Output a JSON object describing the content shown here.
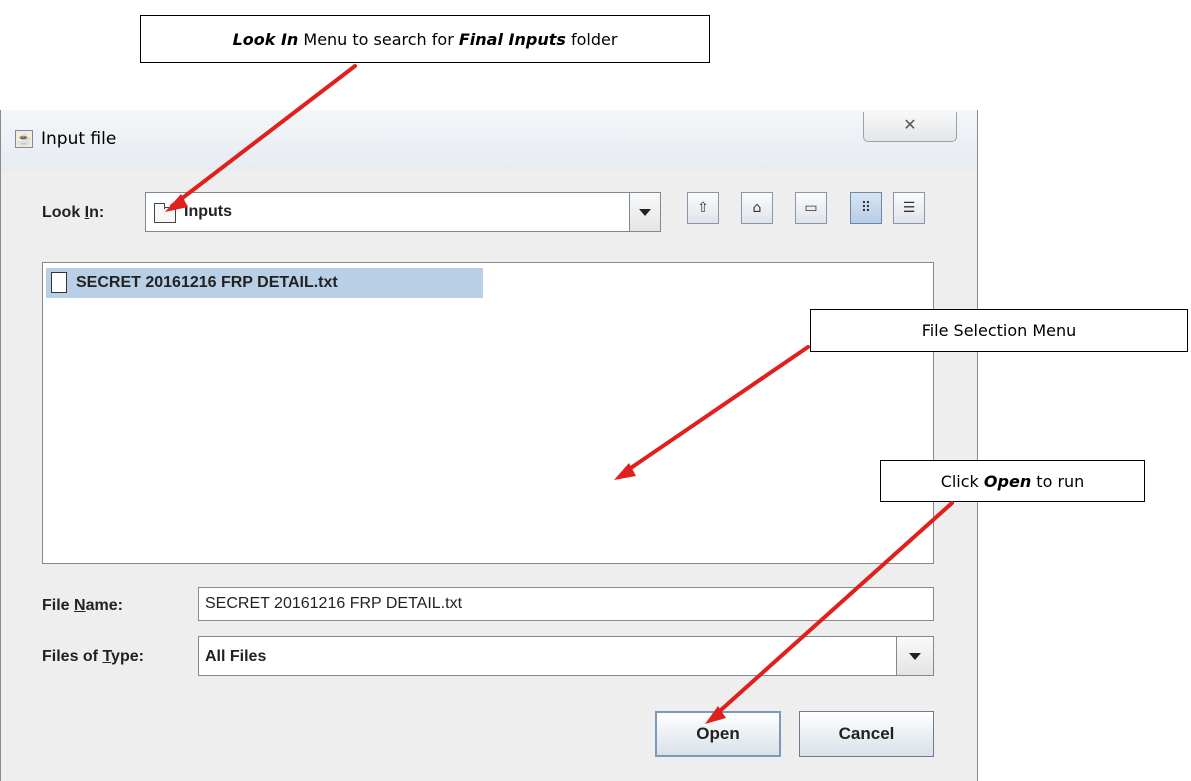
{
  "callouts": {
    "look_in": {
      "bold1": "Look In",
      "text1": " Menu to search for ",
      "bold2": "Final Inputs",
      "text2": " folder"
    },
    "file_selection": {
      "text": "File Selection Menu"
    },
    "open": {
      "text1": "Click ",
      "bold": "Open",
      "text2": " to run"
    }
  },
  "dialog": {
    "title": "Input file",
    "close_glyph": "✕",
    "look_in": {
      "label_pre": "Look ",
      "label_u": "I",
      "label_post": "n:",
      "value": "Inputs"
    },
    "toolbar_icons": [
      "up-one-level-icon",
      "home-icon",
      "new-folder-icon",
      "list-view-icon",
      "details-view-icon"
    ],
    "files": [
      {
        "name": "SECRET 20161216 FRP DETAIL.txt",
        "selected": true
      }
    ],
    "file_name": {
      "label_pre": "File ",
      "label_u": "N",
      "label_post": "ame:",
      "value": "SECRET 20161216 FRP DETAIL.txt"
    },
    "files_of_type": {
      "label_pre": "Files of ",
      "label_u": "T",
      "label_post": "ype:",
      "value": "All Files"
    },
    "buttons": {
      "open": "Open",
      "cancel": "Cancel"
    }
  },
  "colors": {
    "selection": "#b8cfe5",
    "arrow": "#e0201c"
  }
}
